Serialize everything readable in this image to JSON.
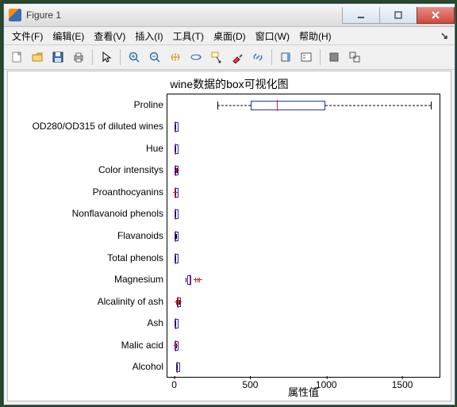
{
  "window": {
    "title": "Figure 1"
  },
  "menus": {
    "file": "文件(F)",
    "edit": "编辑(E)",
    "view": "查看(V)",
    "insert": "插入(I)",
    "tools": "工具(T)",
    "desktop": "桌面(D)",
    "window": "窗口(W)",
    "help": "帮助(H)",
    "curl": "↘"
  },
  "chart_data": {
    "type": "box",
    "title": "wine数据的box可视化图",
    "xlabel": "属性值",
    "xlim": [
      -50,
      1750
    ],
    "xticks": [
      0,
      500,
      1000,
      1500
    ],
    "categories": [
      "Proline",
      "OD280/OD315 of diluted wines",
      "Hue",
      "Color intensitys",
      "Proanthocyanins",
      "Nonflavanoid phenols",
      "Flavanoids",
      "Total phenols",
      "Magnesium",
      "Alcalinity of ash",
      "Ash",
      "Malic acid",
      "Alcohol"
    ],
    "series": [
      {
        "name": "Proline",
        "min": 280,
        "q1": 500,
        "median": 670,
        "q3": 990,
        "max": 1680,
        "outliers": []
      },
      {
        "name": "OD280/OD315 of diluted wines",
        "min": 1.3,
        "q1": 1.9,
        "median": 2.8,
        "q3": 3.2,
        "max": 4.0,
        "outliers": []
      },
      {
        "name": "Hue",
        "min": 0.5,
        "q1": 0.8,
        "median": 1.0,
        "q3": 1.1,
        "max": 1.7,
        "outliers": []
      },
      {
        "name": "Color intensitys",
        "min": 1.3,
        "q1": 3.2,
        "median": 4.7,
        "q3": 6.2,
        "max": 10.5,
        "outliers": [
          11.5,
          13.0
        ]
      },
      {
        "name": "Proanthocyanins",
        "min": 0.4,
        "q1": 1.2,
        "median": 1.6,
        "q3": 2.0,
        "max": 3.2,
        "outliers": [
          3.6
        ]
      },
      {
        "name": "Nonflavanoid phenols",
        "min": 0.13,
        "q1": 0.27,
        "median": 0.34,
        "q3": 0.44,
        "max": 0.66,
        "outliers": []
      },
      {
        "name": "Flavanoids",
        "min": 0.3,
        "q1": 1.2,
        "median": 2.1,
        "q3": 2.9,
        "max": 5.1,
        "outliers": []
      },
      {
        "name": "Total phenols",
        "min": 1.0,
        "q1": 1.7,
        "median": 2.4,
        "q3": 2.8,
        "max": 3.9,
        "outliers": []
      },
      {
        "name": "Magnesium",
        "min": 70,
        "q1": 88,
        "median": 98,
        "q3": 107,
        "max": 135,
        "outliers": [
          139,
          151,
          162
        ]
      },
      {
        "name": "Alcalinity of ash",
        "min": 11,
        "q1": 17,
        "median": 19.5,
        "q3": 21.5,
        "max": 28,
        "outliers": [
          10.6,
          30
        ]
      },
      {
        "name": "Ash",
        "min": 1.4,
        "q1": 2.2,
        "median": 2.4,
        "q3": 2.6,
        "max": 3.2,
        "outliers": []
      },
      {
        "name": "Malic acid",
        "min": 0.7,
        "q1": 1.6,
        "median": 1.9,
        "q3": 3.1,
        "max": 5.1,
        "outliers": [
          5.5,
          5.8
        ]
      },
      {
        "name": "Alcohol",
        "min": 11.0,
        "q1": 12.4,
        "median": 13.1,
        "q3": 13.7,
        "max": 14.8,
        "outliers": []
      }
    ]
  }
}
